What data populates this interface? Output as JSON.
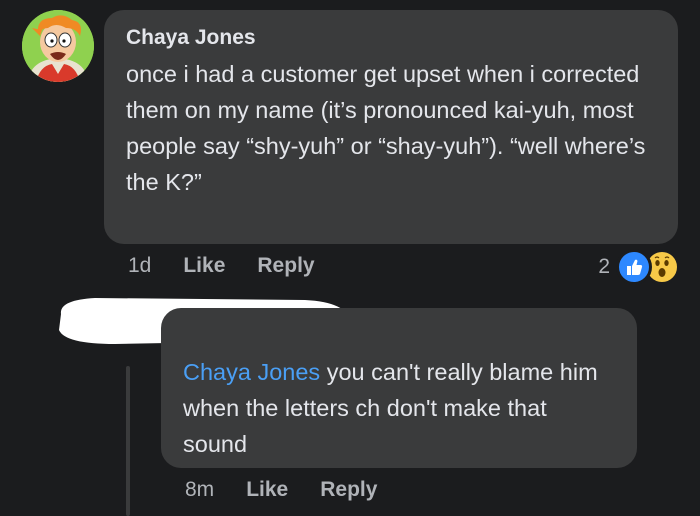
{
  "comment": {
    "author": "Chaya Jones",
    "text": "once i had a customer get upset when i corrected them on my name (it’s pronounced kai-yuh, most people say “shy-yuh” or “shay-yuh”). “well where’s the K?”",
    "time": "1d",
    "like_label": "Like",
    "reply_label": "Reply",
    "reaction_count": "2",
    "reactions": [
      "like-icon",
      "wow-icon"
    ],
    "avatar": "cartoon-avatar"
  },
  "reply": {
    "author": "",
    "mention": "Chaya Jones",
    "text": " you can't really blame him when the letters ch don't make that sound",
    "time": "8m",
    "like_label": "Like",
    "reply_label": "Reply"
  },
  "colors": {
    "background": "#1b1c1e",
    "bubble": "#3a3b3c",
    "text": "#e4e6eb",
    "muted": "#b0b3b8",
    "mention": "#4a9ff5",
    "like_blue": "#2d88ff",
    "wow_yellow": "#f7c948"
  }
}
